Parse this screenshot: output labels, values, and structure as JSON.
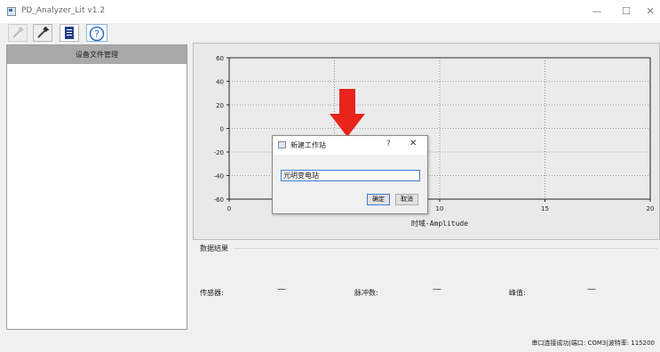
{
  "window": {
    "title": "PD_Analyzer_Lit v1.2"
  },
  "window_controls": {
    "minimize": "—",
    "maximize": "☐",
    "close": "✕"
  },
  "toolbar": {
    "buttons": [
      {
        "icon": "connect-plug-icon",
        "enabled": false
      },
      {
        "icon": "disconnect-plug-icon",
        "enabled": true
      },
      {
        "icon": "document-icon",
        "enabled": true
      },
      {
        "icon": "help-icon",
        "label": "?",
        "enabled": true
      }
    ]
  },
  "left_panel": {
    "header": "设备文件管理"
  },
  "chart_data": {
    "type": "line",
    "title": "",
    "xlabel": "时域-Amplitude",
    "ylabel": "",
    "xlim": [
      0,
      20
    ],
    "ylim": [
      -60,
      60
    ],
    "x_ticks": [
      0,
      5,
      10,
      15,
      20
    ],
    "y_ticks": [
      60,
      40,
      20,
      0,
      -20,
      -40,
      -60
    ],
    "grid": true,
    "series": []
  },
  "results": {
    "title": "数据结果",
    "items": [
      {
        "label": "传感器:",
        "value": "—"
      },
      {
        "label": "脉冲数:",
        "value": "—"
      },
      {
        "label": "峰值:",
        "value": "—"
      }
    ]
  },
  "status": {
    "text": "串口连接成功|端口: COM3|波特率: 115200"
  },
  "dialog": {
    "title": "新建工作站",
    "help": "?",
    "close": "✕",
    "input_value": "光明变电站",
    "ok_label": "确定",
    "cancel_label": "取消"
  },
  "annotation": {
    "arrow_color": "#e8241c"
  }
}
